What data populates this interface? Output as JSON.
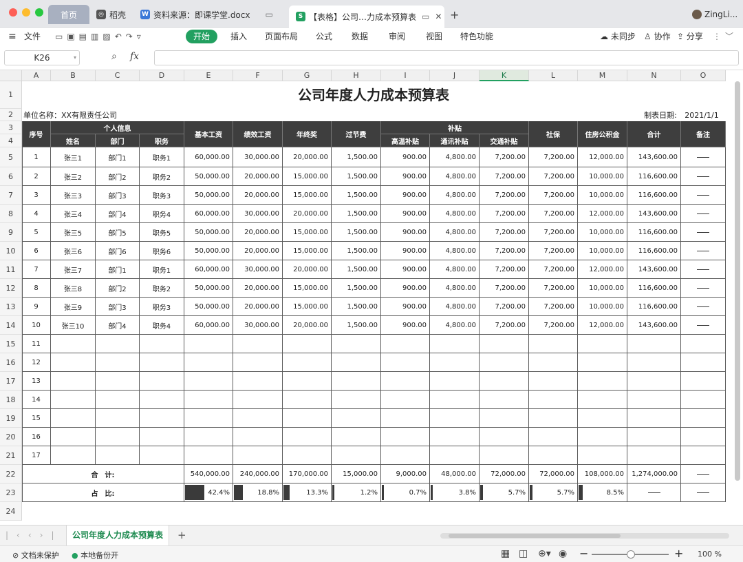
{
  "window": {
    "tabs": [
      {
        "label": "首页"
      },
      {
        "label": "稻壳"
      },
      {
        "label": "资料来源：即课学堂.docx"
      },
      {
        "label": "【表格】公司…力成本预算表"
      }
    ],
    "user": "ZingLi...",
    "add_tab": "+"
  },
  "toolbar": {
    "file": "文件",
    "menus": [
      "开始",
      "插入",
      "页面布局",
      "公式",
      "数据",
      "审阅",
      "视图",
      "特色功能"
    ],
    "sync": "未同步",
    "collab": "协作",
    "share": "分享"
  },
  "formula_bar": {
    "cell_ref": "K26",
    "fx": "fx",
    "value": ""
  },
  "columns": [
    "A",
    "B",
    "C",
    "D",
    "E",
    "F",
    "G",
    "H",
    "I",
    "J",
    "K",
    "L",
    "M",
    "N",
    "O"
  ],
  "selected_column": "K",
  "rows": [
    "1",
    "2",
    "3",
    "4",
    "5",
    "6",
    "7",
    "8",
    "9",
    "10",
    "11",
    "12",
    "13",
    "14",
    "15",
    "16",
    "17",
    "18",
    "19",
    "20",
    "21",
    "22",
    "23",
    "24"
  ],
  "sheet": {
    "title": "公司年度人力成本预算表",
    "unit_label": "单位名称：XX有限责任公司",
    "date_label": "制表日期:",
    "date_value": "2021/1/1",
    "headers": {
      "seq": "序号",
      "personal": "个人信息",
      "name": "姓名",
      "dept": "部门",
      "role": "职务",
      "base": "基本工资",
      "perf": "绩效工资",
      "bonus": "年终奖",
      "holiday": "过节费",
      "allowance": "补贴",
      "heat": "高温补贴",
      "comm": "通讯补贴",
      "traffic": "交通补贴",
      "social": "社保",
      "housing": "住房公积金",
      "total": "合计",
      "note": "备注"
    },
    "records": [
      [
        "1",
        "张三1",
        "部门1",
        "职务1",
        "60,000.00",
        "30,000.00",
        "20,000.00",
        "1,500.00",
        "900.00",
        "4,800.00",
        "7,200.00",
        "7,200.00",
        "12,000.00",
        "143,600.00"
      ],
      [
        "2",
        "张三2",
        "部门2",
        "职务2",
        "50,000.00",
        "20,000.00",
        "15,000.00",
        "1,500.00",
        "900.00",
        "4,800.00",
        "7,200.00",
        "7,200.00",
        "10,000.00",
        "116,600.00"
      ],
      [
        "3",
        "张三3",
        "部门3",
        "职务3",
        "50,000.00",
        "20,000.00",
        "15,000.00",
        "1,500.00",
        "900.00",
        "4,800.00",
        "7,200.00",
        "7,200.00",
        "10,000.00",
        "116,600.00"
      ],
      [
        "4",
        "张三4",
        "部门4",
        "职务4",
        "60,000.00",
        "30,000.00",
        "20,000.00",
        "1,500.00",
        "900.00",
        "4,800.00",
        "7,200.00",
        "7,200.00",
        "12,000.00",
        "143,600.00"
      ],
      [
        "5",
        "张三5",
        "部门5",
        "职务5",
        "50,000.00",
        "20,000.00",
        "15,000.00",
        "1,500.00",
        "900.00",
        "4,800.00",
        "7,200.00",
        "7,200.00",
        "10,000.00",
        "116,600.00"
      ],
      [
        "6",
        "张三6",
        "部门6",
        "职务6",
        "50,000.00",
        "20,000.00",
        "15,000.00",
        "1,500.00",
        "900.00",
        "4,800.00",
        "7,200.00",
        "7,200.00",
        "10,000.00",
        "116,600.00"
      ],
      [
        "7",
        "张三7",
        "部门1",
        "职务1",
        "60,000.00",
        "30,000.00",
        "20,000.00",
        "1,500.00",
        "900.00",
        "4,800.00",
        "7,200.00",
        "7,200.00",
        "12,000.00",
        "143,600.00"
      ],
      [
        "8",
        "张三8",
        "部门2",
        "职务2",
        "50,000.00",
        "20,000.00",
        "15,000.00",
        "1,500.00",
        "900.00",
        "4,800.00",
        "7,200.00",
        "7,200.00",
        "10,000.00",
        "116,600.00"
      ],
      [
        "9",
        "张三9",
        "部门3",
        "职务3",
        "50,000.00",
        "20,000.00",
        "15,000.00",
        "1,500.00",
        "900.00",
        "4,800.00",
        "7,200.00",
        "7,200.00",
        "10,000.00",
        "116,600.00"
      ],
      [
        "10",
        "张三10",
        "部门4",
        "职务4",
        "60,000.00",
        "30,000.00",
        "20,000.00",
        "1,500.00",
        "900.00",
        "4,800.00",
        "7,200.00",
        "7,200.00",
        "12,000.00",
        "143,600.00"
      ]
    ],
    "empty_seq": [
      "11",
      "12",
      "13",
      "14",
      "15",
      "16",
      "17"
    ],
    "total_label": "合　计:",
    "totals": [
      "540,000.00",
      "240,000.00",
      "170,000.00",
      "15,000.00",
      "9,000.00",
      "48,000.00",
      "72,000.00",
      "72,000.00",
      "108,000.00",
      "1,274,000.00"
    ],
    "ratio_label": "占　比:",
    "ratios": [
      {
        "text": "42.4%",
        "value": 0.424
      },
      {
        "text": "18.8%",
        "value": 0.188
      },
      {
        "text": "13.3%",
        "value": 0.133
      },
      {
        "text": "1.2%",
        "value": 0.012
      },
      {
        "text": "0.7%",
        "value": 0.007
      },
      {
        "text": "3.8%",
        "value": 0.038
      },
      {
        "text": "5.7%",
        "value": 0.057
      },
      {
        "text": "5.7%",
        "value": 0.057
      },
      {
        "text": "8.5%",
        "value": 0.085
      }
    ]
  },
  "sheet_tabs": {
    "active": "公司年度人力成本预算表",
    "add": "+"
  },
  "status": {
    "protect": "文档未保护",
    "backup": "本地备份开",
    "zoom": "100 %"
  }
}
